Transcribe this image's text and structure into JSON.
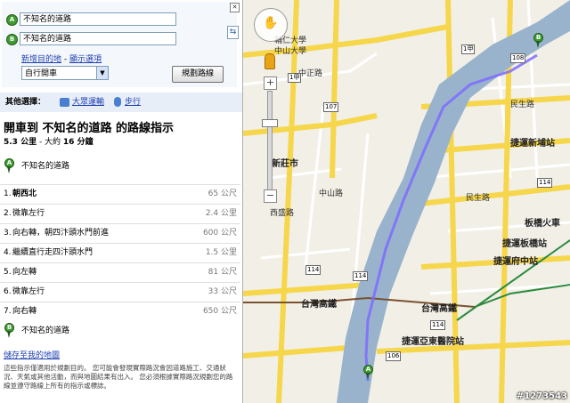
{
  "directions_form": {
    "start_marker": "A",
    "end_marker": "B",
    "start_value": "不知名的道路",
    "end_value": "不知名的道路",
    "close_icon": "close-icon",
    "swap_icon": "swap-icon",
    "add_destination_link": "新增目的地",
    "separator": " - ",
    "show_options_link": "顯示選項",
    "mode_select_value": "自行開車",
    "submit_label": "規劃路線"
  },
  "other_options": {
    "label": "其他選擇：",
    "transit_label": "大眾運輸",
    "walk_label": "步行"
  },
  "route": {
    "title": "開車到 不知名的道路 的路線指示",
    "summary_distance": "5.3 公里",
    "summary_sep": " - 大約 ",
    "summary_time": "16 分鐘",
    "start_label": "不知名的道路",
    "end_label": "不知名的道路",
    "steps": [
      {
        "num": "1.",
        "text": "朝西北",
        "dist": "65 公尺"
      },
      {
        "num": "2.",
        "text": "微靠左行",
        "dist": "2.4 公里"
      },
      {
        "num": "3.",
        "text": "向右轉，朝四汴頭水門前進",
        "dist": "600 公尺"
      },
      {
        "num": "4.",
        "text": "繼續直行走四汴頭水門",
        "dist": "1.5 公里"
      },
      {
        "num": "5.",
        "text": "向左轉",
        "dist": "81 公尺"
      },
      {
        "num": "6.",
        "text": "微靠左行",
        "dist": "33 公尺"
      },
      {
        "num": "7.",
        "text": "向右轉",
        "dist": "650 公尺"
      }
    ],
    "save_link": "儲存至我的地圖",
    "note": "這些指示僅適用於規劃目的。 您可能會發現實際路況會因道路施工、交通狀況、天氣或其他活動，而與地圖結果有出入。 您必須根據實際路況規劃您的路線並遵守路線上所有的指示或標誌。"
  },
  "map": {
    "labels": {
      "nsysu": "輔仁大學",
      "nsysu2": "中山大學",
      "xinzhuang": "新莊市",
      "jieyun_xinpu": "捷運新埔站",
      "banqiao_station": "板橋火車",
      "jieyun_banqiao": "捷運板橋站",
      "jieyun_fuzhong": "捷運府中站",
      "taiwan_high": "台灣高鐵",
      "taiwan_high2": "台灣高鐵",
      "jieyun_yadong": "捷運亞東醫院站",
      "zhongzheng": "中正路",
      "zhongshan": "中山路",
      "minsheng": "民生路",
      "xiwan": "西盛路",
      "minsheng2": "民生路"
    },
    "shields": [
      "107",
      "114",
      "114",
      "108",
      "1甲",
      "114",
      "106",
      "114",
      "1甲"
    ],
    "route_marker_start": "A",
    "route_marker_end": "B",
    "watermark": "#1273543",
    "pan_icon": "hand-pan-icon",
    "pegman_icon": "pegman-icon",
    "zoom_in": "+",
    "zoom_out": "−"
  }
}
